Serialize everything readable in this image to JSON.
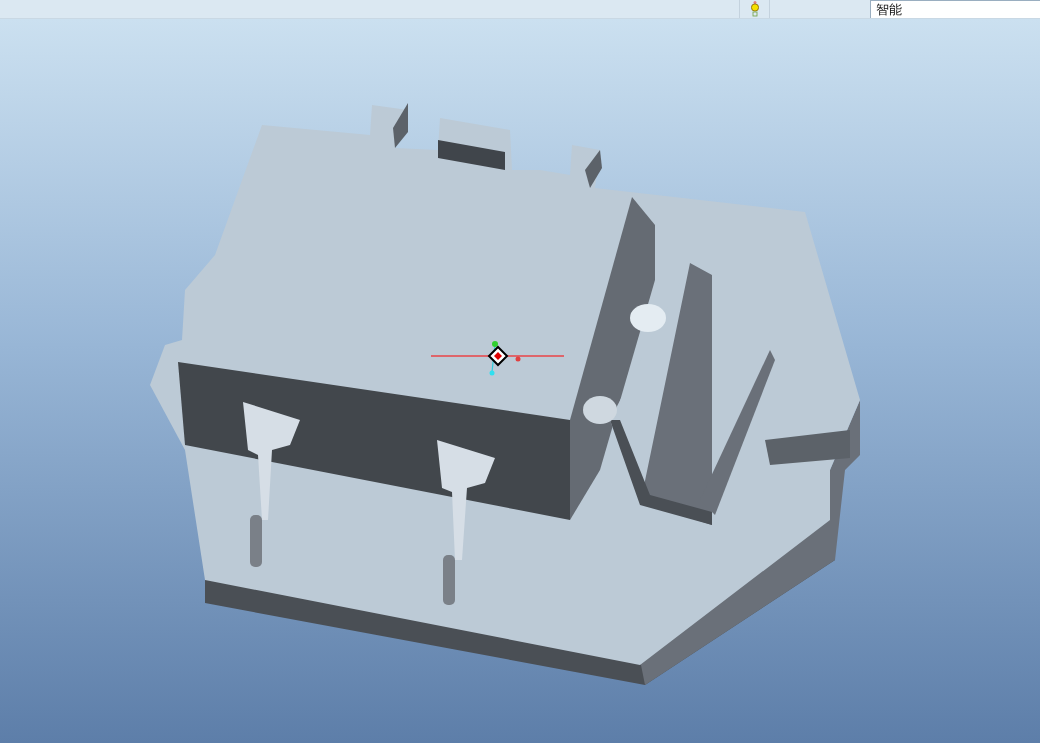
{
  "status_bar": {
    "filter": {
      "value": "智能"
    }
  }
}
